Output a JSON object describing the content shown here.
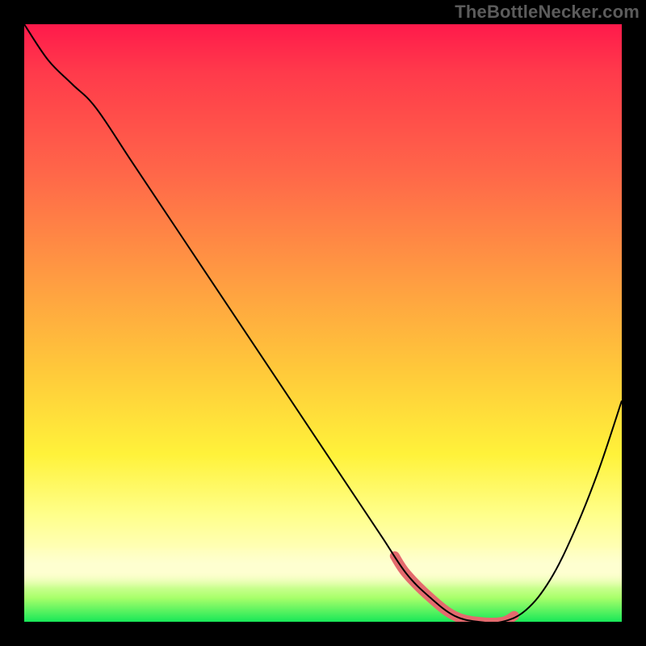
{
  "watermark": "TheBottleNecker.com",
  "chart_data": {
    "type": "line",
    "title": "",
    "xlabel": "",
    "ylabel": "",
    "xlim": [
      0,
      100
    ],
    "ylim": [
      0,
      100
    ],
    "x": [
      0,
      4,
      8,
      12,
      18,
      26,
      34,
      42,
      50,
      56,
      60,
      64,
      68,
      72,
      76,
      80,
      84,
      88,
      92,
      96,
      100
    ],
    "values": [
      100,
      94,
      90,
      86,
      77,
      65,
      53,
      41,
      29,
      20,
      14,
      8,
      4,
      1,
      0,
      0,
      2,
      7,
      15,
      25,
      37
    ],
    "highlight_range_x": [
      62,
      82
    ],
    "gradient_stops": [
      {
        "pos": 0.0,
        "color": "#ff1a4b"
      },
      {
        "pos": 0.25,
        "color": "#ff6749"
      },
      {
        "pos": 0.58,
        "color": "#ffc93a"
      },
      {
        "pos": 0.82,
        "color": "#ffff8a"
      },
      {
        "pos": 0.96,
        "color": "#a8ff6a"
      },
      {
        "pos": 1.0,
        "color": "#18e858"
      }
    ],
    "highlight_color": "#e46a6e",
    "line_color": "#000000"
  }
}
